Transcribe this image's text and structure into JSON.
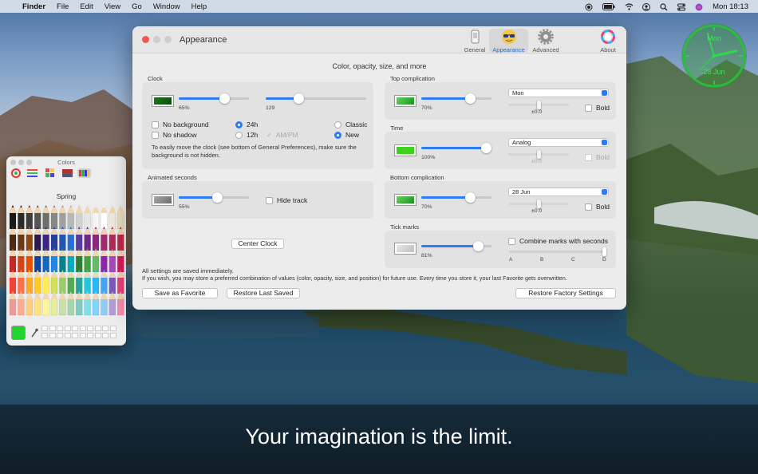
{
  "menubar": {
    "apple_icon": "apple-icon",
    "items": [
      "Finder",
      "File",
      "Edit",
      "View",
      "Go",
      "Window",
      "Help"
    ],
    "clock": "Mon 18:13"
  },
  "window": {
    "title": "Appearance",
    "toolbar": [
      {
        "label": "General",
        "icon": "phone-icon"
      },
      {
        "label": "Appearance",
        "icon": "sunglasses-icon",
        "selected": true
      },
      {
        "label": "Advanced",
        "icon": "gear-icon"
      },
      {
        "label": "About",
        "icon": "color-ring-icon"
      }
    ],
    "heading": "Color, opacity, size, and more",
    "clock": {
      "label": "Clock",
      "opacity_value": "65%",
      "opacity_level": 0.65,
      "size_value": "129",
      "size_level": 0.33,
      "no_background": "No background",
      "no_shadow": "No shadow",
      "h24": "24h",
      "h12": "12h",
      "ampm": "AM/PM",
      "classic": "Classic",
      "new": "New",
      "note": "To easily move the clock (see bottom of General Preferences), make sure the background is not hidden."
    },
    "animated_seconds": {
      "label": "Animated seconds",
      "value": "55%",
      "level": 0.55,
      "hide_track": "Hide track"
    },
    "center_clock": "Center Clock",
    "top_complication": {
      "label": "Top complication",
      "value": "70%",
      "level": 0.7,
      "select": "Mon",
      "offset": "±0.0",
      "bold": "Bold"
    },
    "time": {
      "label": "Time",
      "value": "100%",
      "level": 1.0,
      "select": "Analog",
      "offset": "±0.0",
      "bold": "Bold"
    },
    "bottom_complication": {
      "label": "Bottom complication",
      "value": "70%",
      "level": 0.7,
      "select": "28 Jun",
      "offset": "±0.0",
      "bold": "Bold"
    },
    "tick_marks": {
      "label": "Tick marks",
      "value": "81%",
      "level": 0.81,
      "combine": "Combine marks with seconds",
      "ticks": [
        "A",
        "B",
        "C",
        "D"
      ]
    },
    "footer_note_1": "All settings are saved immediately.",
    "footer_note_2": "If you wish, you may store a preferred combination of values (color, opacity, size, and position) for future use. Every time you store it, your last Favorite gets overwritten.",
    "save_favorite": "Save as Favorite",
    "restore_last": "Restore Last Saved",
    "restore_factory": "Restore Factory Settings"
  },
  "colors_panel": {
    "title": "Colors",
    "set_name": "Spring",
    "current_color": "#22d42e"
  },
  "desktop_clock": {
    "top_text": "Mon",
    "bottom_text": "28 Jun",
    "accent": "#27c23a"
  },
  "tagline": "Your imagination is the limit."
}
